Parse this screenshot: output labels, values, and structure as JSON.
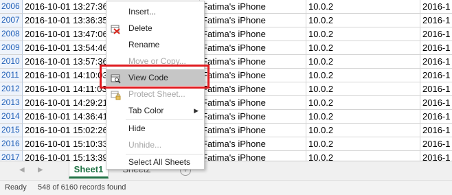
{
  "rows": [
    {
      "num": "2006",
      "datetime": "2016-10-01 13:27:36",
      "device": "Fatima's iPhone",
      "version": "10.0.2",
      "next": "2016-1"
    },
    {
      "num": "2007",
      "datetime": "2016-10-01 13:36:35",
      "device": "Fatima's iPhone",
      "version": "10.0.2",
      "next": "2016-1"
    },
    {
      "num": "2008",
      "datetime": "2016-10-01 13:47:06",
      "device": "Fatima's iPhone",
      "version": "10.0.2",
      "next": "2016-1"
    },
    {
      "num": "2009",
      "datetime": "2016-10-01 13:54:46",
      "device": "Fatima's iPhone",
      "version": "10.0.2",
      "next": "2016-1"
    },
    {
      "num": "2010",
      "datetime": "2016-10-01 13:57:36",
      "device": "Fatima's iPhone",
      "version": "10.0.2",
      "next": "2016-1"
    },
    {
      "num": "2011",
      "datetime": "2016-10-01 14:10:03",
      "device": "Fatima's iPhone",
      "version": "10.0.2",
      "next": "2016-1"
    },
    {
      "num": "2012",
      "datetime": "2016-10-01 14:11:03",
      "device": "Fatima's iPhone",
      "version": "10.0.2",
      "next": "2016-1"
    },
    {
      "num": "2013",
      "datetime": "2016-10-01 14:29:21",
      "device": "Fatima's iPhone",
      "version": "10.0.2",
      "next": "2016-1"
    },
    {
      "num": "2014",
      "datetime": "2016-10-01 14:36:41",
      "device": "Fatima's iPhone",
      "version": "10.0.2",
      "next": "2016-1"
    },
    {
      "num": "2015",
      "datetime": "2016-10-01 15:02:26",
      "device": "Fatima's iPhone",
      "version": "10.0.2",
      "next": "2016-1"
    },
    {
      "num": "2016",
      "datetime": "2016-10-01 15:10:33",
      "device": "Fatima's iPhone",
      "version": "10.0.2",
      "next": "2016-1"
    },
    {
      "num": "2017",
      "datetime": "2016-10-01 15:13:39",
      "device": "Fatima's iPhone",
      "version": "10.0.2",
      "next": "2016-1"
    }
  ],
  "context_menu": {
    "items": [
      {
        "label": "Insert...",
        "enabled": true,
        "icon": ""
      },
      {
        "label": "Delete",
        "enabled": true,
        "icon": "delete-sheet-icon"
      },
      {
        "label": "Rename",
        "enabled": true,
        "icon": ""
      },
      {
        "label": "Move or Copy...",
        "enabled": false,
        "icon": ""
      },
      {
        "label": "View Code",
        "enabled": true,
        "icon": "view-code-icon"
      },
      {
        "label": "Protect Sheet...",
        "enabled": false,
        "icon": "protect-sheet-icon"
      },
      {
        "label": "Tab Color",
        "enabled": true,
        "icon": "",
        "submenu": true
      },
      {
        "label": "Hide",
        "enabled": true,
        "icon": ""
      },
      {
        "label": "Unhide...",
        "enabled": false,
        "icon": ""
      },
      {
        "label": "Select All Sheets",
        "enabled": true,
        "icon": ""
      }
    ],
    "highlighted_item": "View Code",
    "highlight_color": "#e0191e"
  },
  "tabs": {
    "active": "Sheet1",
    "other": "Sheet2",
    "add_icon": "plus-circle-icon",
    "nav_icons": [
      "nav-left-icon",
      "nav-right-icon"
    ]
  },
  "status": {
    "ready": "Ready",
    "records": "548 of 6160 records found"
  },
  "colors": {
    "accent": "#217346",
    "rownum_text": "#1f5fb8"
  }
}
